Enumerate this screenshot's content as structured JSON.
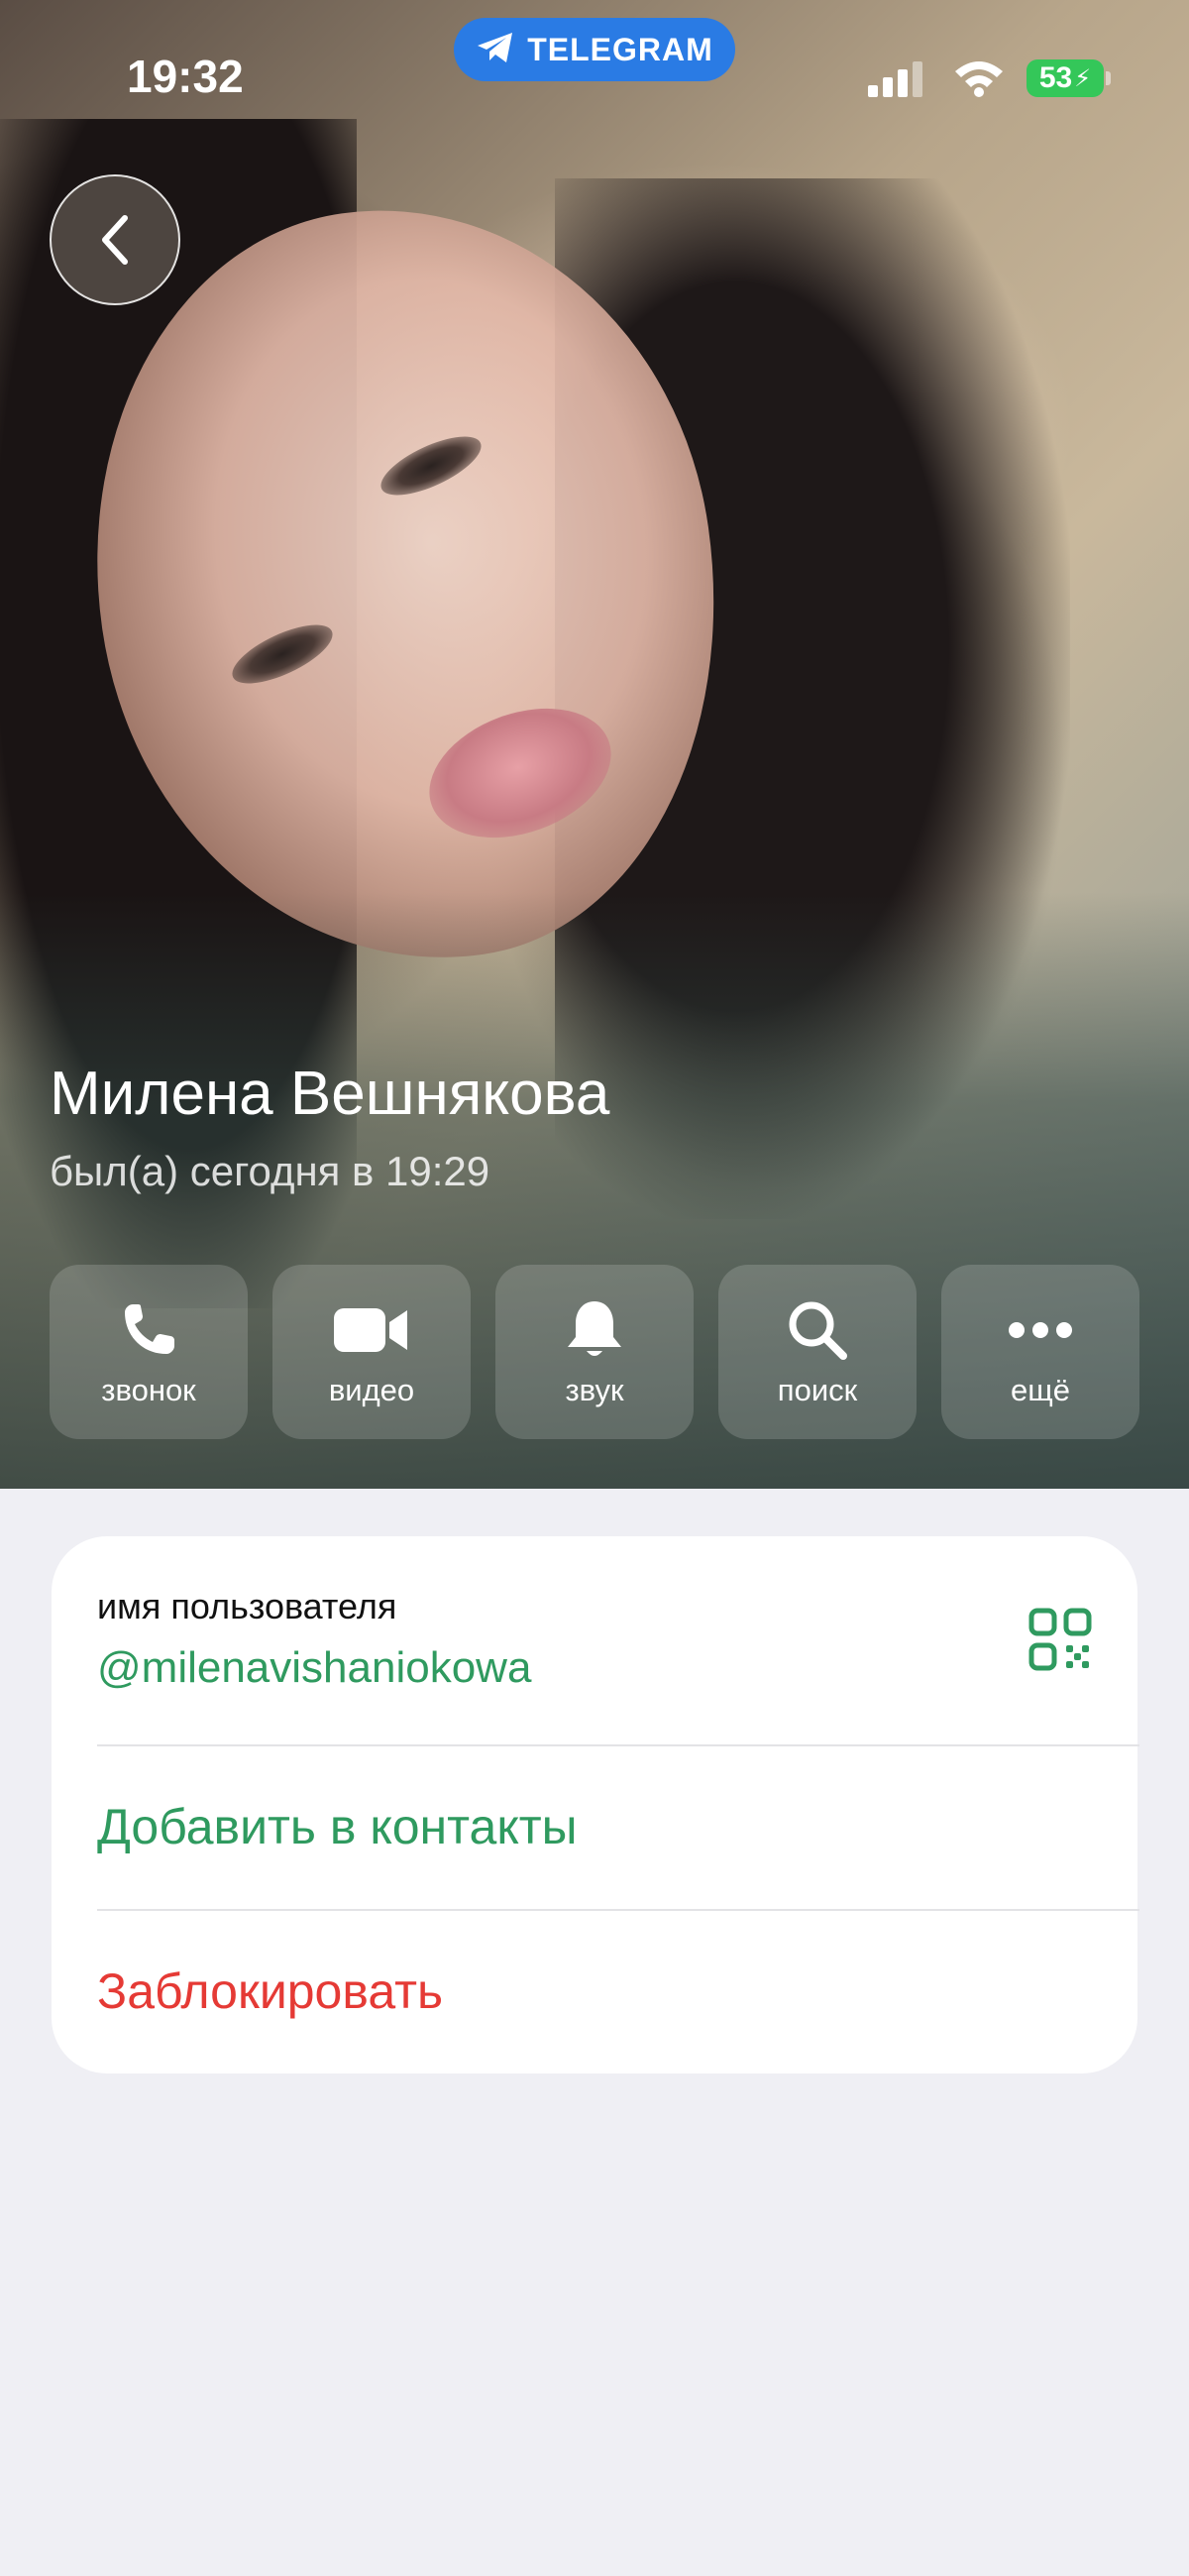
{
  "status_bar": {
    "time": "19:32",
    "app_pill": "TELEGRAM",
    "battery": "53"
  },
  "profile": {
    "name": "Милена Вешнякова",
    "last_seen": "был(а) сегодня в 19:29"
  },
  "actions": [
    {
      "label": "звонок",
      "icon": "phone-icon"
    },
    {
      "label": "видео",
      "icon": "video-camera-icon"
    },
    {
      "label": "звук",
      "icon": "bell-icon"
    },
    {
      "label": "поиск",
      "icon": "search-icon"
    },
    {
      "label": "ещё",
      "icon": "more-dots-icon"
    }
  ],
  "info": {
    "username_label": "имя пользователя",
    "username": "@milenavishaniokowa",
    "add_contact": "Добавить в контакты",
    "block": "Заблокировать"
  },
  "colors": {
    "accent_green": "#2f9a5f",
    "danger_red": "#e53a35",
    "telegram_blue": "#2a7be4",
    "battery_green": "#34c759",
    "background": "#efeff4"
  }
}
